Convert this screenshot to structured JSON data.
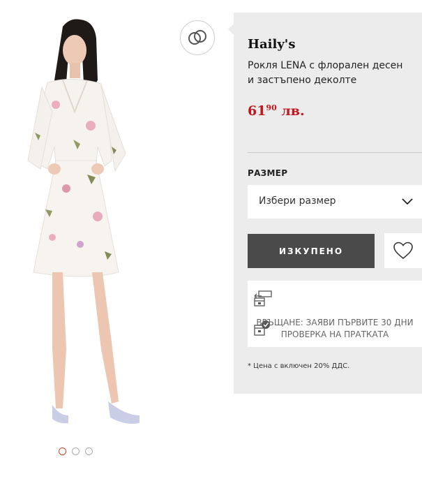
{
  "product": {
    "brand": "Haily's",
    "title": "Рокля LENA с флорален десен и застъпено деколте",
    "price_main": "61",
    "price_decimal": "90",
    "price_currency": "лв.",
    "image_alt": "Рокля LENA"
  },
  "gallery": {
    "dots_count": 3,
    "active_index": 0
  },
  "size": {
    "label": "РАЗМЕР",
    "placeholder": "Избери размер"
  },
  "actions": {
    "sold_label": "ИЗКУПЕНО"
  },
  "returns": {
    "line1": "ВРЪЩАНЕ: ЗАЯВИ ПЪРВИТЕ 30 ДНИ",
    "line2": "ПРОВЕРКА НА ПРАТКАТА"
  },
  "note": "* Цена с включен 20% ДДС.",
  "colors": {
    "price": "#c4161c",
    "button_dark": "#4a4a4a",
    "panel_bg": "#ececec"
  }
}
